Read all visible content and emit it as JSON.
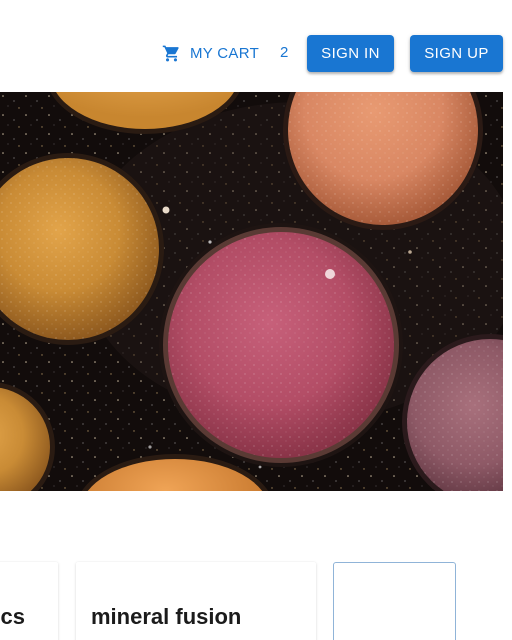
{
  "header": {
    "cart_label": "MY CART",
    "cart_icon": "shopping-cart-icon",
    "cart_count": "2",
    "sign_in_label": "SIGN IN",
    "sign_up_label": "SIGN UP"
  },
  "hero": {
    "image": "eyeshadow-palette-photo"
  },
  "products": [
    {
      "title": "cs"
    },
    {
      "title": "mineral fusion"
    },
    {
      "title": ""
    }
  ],
  "colors": {
    "primary": "#1976d2",
    "text": "#1b1b1b"
  }
}
